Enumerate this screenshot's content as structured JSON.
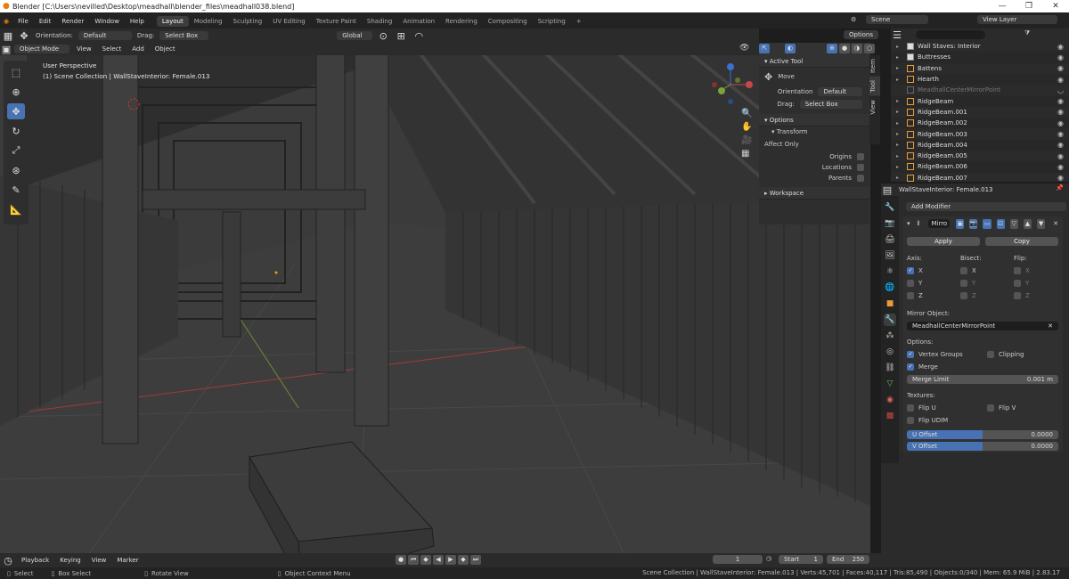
{
  "window": {
    "title": "Blender [C:\\Users\\nevilled\\Desktop\\meadhall\\blender_files\\meadhall038.blend]",
    "minimize": "—",
    "maximize": "❐",
    "close": "✕"
  },
  "menubar": {
    "menus": [
      "File",
      "Edit",
      "Render",
      "Window",
      "Help"
    ],
    "workspaces": [
      "Layout",
      "Modeling",
      "Sculpting",
      "UV Editing",
      "Texture Paint",
      "Shading",
      "Animation",
      "Rendering",
      "Compositing",
      "Scripting"
    ],
    "active_workspace": "Layout",
    "add_workspace": "+",
    "scene": "Scene",
    "view_layer": "View Layer"
  },
  "viewport_header": {
    "orientation_label": "Orientation:",
    "orientation_value": "Default",
    "drag_label": "Drag:",
    "drag_value": "Select Box",
    "transform_orientation": "Global",
    "options": "Options",
    "mode": "Object Mode",
    "menus": [
      "View",
      "Select",
      "Add",
      "Object"
    ]
  },
  "viewport": {
    "perspective": "User Perspective",
    "collection": "(1) Scene Collection | WallStaveInterior: Female.013"
  },
  "npanel": {
    "active_tool_title": "Active Tool",
    "tool_name": "Move",
    "orientation_label": "Orientation",
    "orientation_value": "Default",
    "drag_label": "Drag:",
    "drag_value": "Select Box",
    "options_title": "Options",
    "transform_title": "Transform",
    "affect_only": "Affect Only",
    "origins": "Origins",
    "locations": "Locations",
    "parents": "Parents",
    "workspace_title": "Workspace",
    "tabs": [
      "Item",
      "Tool",
      "View"
    ]
  },
  "outliner": {
    "rows": [
      {
        "name": "Wall Staves: Interior",
        "dim": false
      },
      {
        "name": "Buttresses",
        "dim": false
      },
      {
        "name": "Battens",
        "dim": false
      },
      {
        "name": "Hearth",
        "dim": false
      },
      {
        "name": "MeadhallCenterMirrorPoint",
        "dim": true
      },
      {
        "name": "RidgeBeam",
        "dim": false
      },
      {
        "name": "RidgeBeam.001",
        "dim": false
      },
      {
        "name": "RidgeBeam.002",
        "dim": false
      },
      {
        "name": "RidgeBeam.003",
        "dim": false
      },
      {
        "name": "RidgeBeam.004",
        "dim": false
      },
      {
        "name": "RidgeBeam.005",
        "dim": false
      },
      {
        "name": "RidgeBeam.006",
        "dim": false
      },
      {
        "name": "RidgeBeam.007",
        "dim": false
      }
    ]
  },
  "properties": {
    "object_name": "WallStaveInterior: Female.013",
    "add_modifier": "Add Modifier",
    "modifier_name": "Mirro",
    "apply": "Apply",
    "copy": "Copy",
    "axis_label": "Axis:",
    "bisect_label": "Bisect:",
    "flip_label": "Flip:",
    "axes": [
      "X",
      "Y",
      "Z"
    ],
    "mirror_object_label": "Mirror Object:",
    "mirror_object_value": "MeadhallCenterMirrorPoint",
    "options_label": "Options:",
    "vertex_groups": "Vertex Groups",
    "clipping": "Clipping",
    "merge": "Merge",
    "merge_limit_label": "Merge Limit",
    "merge_limit_value": "0.001 m",
    "textures_label": "Textures:",
    "flip_u": "Flip U",
    "flip_v": "Flip V",
    "flip_udim": "Flip UDIM",
    "u_offset_label": "U Offset",
    "u_offset_value": "0.0000",
    "v_offset_label": "V Offset",
    "v_offset_value": "0.0000"
  },
  "timeline": {
    "playback": "Playback",
    "keying": "Keying",
    "view": "View",
    "marker": "Marker",
    "current_frame": "1",
    "start_label": "Start",
    "start_value": "1",
    "end_label": "End",
    "end_value": "250"
  },
  "statusbar": {
    "select": "Select",
    "box_select": "Box Select",
    "rotate_view": "Rotate View",
    "context_menu": "Object Context Menu",
    "stats": "Scene Collection | WallStaveInterior: Female.013 | Verts:45,701 | Faces:40,117 | Tris:85,490 | Objects:0/340 | Mem: 65.9 MiB | 2.83.17"
  },
  "colors": {
    "accent": "#4772b3",
    "viewport_bg": "#3b3b3b",
    "x_axis": "#c8464d",
    "y_axis": "#7aa33b"
  }
}
